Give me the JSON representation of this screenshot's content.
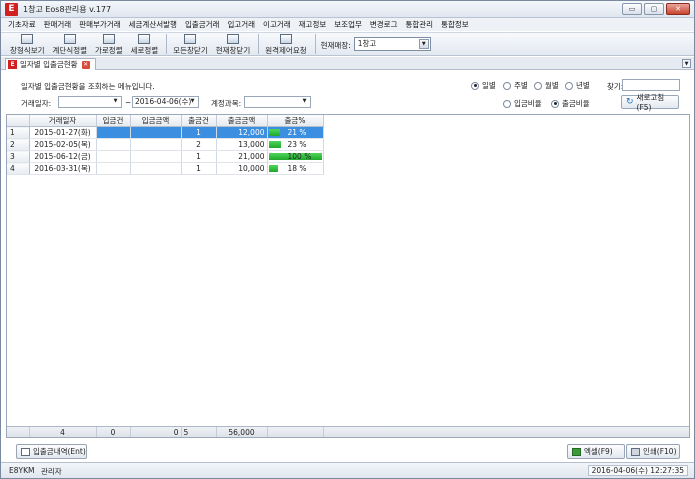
{
  "window": {
    "title": "1창고 Eos8관리용 v.177",
    "logo": "E",
    "btn_min": "▭",
    "btn_max": "▢",
    "btn_close": "✕"
  },
  "menu": [
    "기초자료",
    "판매거래",
    "판매부가거래",
    "세금계산서발행",
    "입출금거래",
    "입고거래",
    "이고거래",
    "재고정보",
    "보조업무",
    "변경로그",
    "통합관리",
    "통합정보"
  ],
  "toolbar": {
    "buttons": [
      "창형식보기",
      "계단식정렬",
      "가로정렬",
      "세로정렬",
      "모든창닫기",
      "현재창닫기",
      "원격제어요청"
    ],
    "store_label": "현재매장:",
    "store_value": "1창고"
  },
  "tab": {
    "label": "일자별 입출금현황",
    "logo": "E",
    "close": "✕",
    "menu_arrow": "▼"
  },
  "filters": {
    "description": "일자별 입출금현황을 조회하는 메뉴입니다.",
    "date_label": "거래일자:",
    "date_from": "",
    "date_sep": "~",
    "date_to": "2016-04-06(수)",
    "account_label": "계정과목:",
    "account_value": "",
    "find_label": "찾기:",
    "find_value": "",
    "period_options": [
      {
        "label": "일별",
        "selected": true
      },
      {
        "label": "주별",
        "selected": false
      },
      {
        "label": "월별",
        "selected": false
      },
      {
        "label": "년별",
        "selected": false
      }
    ],
    "ratio_options": [
      {
        "label": "입금비율",
        "selected": false
      },
      {
        "label": "출금비율",
        "selected": true
      }
    ],
    "refresh_label": "새로고침(F5)",
    "refresh_icon": "↻"
  },
  "grid": {
    "columns": [
      "거래일자",
      "입금건",
      "입금금액",
      "출금건",
      "출금금액",
      "출금%"
    ],
    "rows": [
      {
        "no": "1",
        "date": "2015-01-27(화)",
        "in_cnt": "",
        "in_amt": "",
        "out_cnt": "1",
        "out_amt": "12,000",
        "pct": 21,
        "pct_text": "21 %"
      },
      {
        "no": "2",
        "date": "2015-02-05(목)",
        "in_cnt": "",
        "in_amt": "",
        "out_cnt": "2",
        "out_amt": "13,000",
        "pct": 23,
        "pct_text": "23 %"
      },
      {
        "no": "3",
        "date": "2015-06-12(금)",
        "in_cnt": "",
        "in_amt": "",
        "out_cnt": "1",
        "out_amt": "21,000",
        "pct": 100,
        "pct_text": "100 %"
      },
      {
        "no": "4",
        "date": "2016-03-31(목)",
        "in_cnt": "",
        "in_amt": "",
        "out_cnt": "1",
        "out_amt": "10,000",
        "pct": 18,
        "pct_text": "18 %"
      }
    ],
    "totals": {
      "date": "4",
      "in_cnt": "0",
      "in_amt": "0",
      "out_cnt": "5",
      "out_amt": "56,000"
    }
  },
  "buttons": {
    "detail": "입출금내역(Ent)",
    "excel": "엑셀(F9)",
    "print": "인쇄(F10)"
  },
  "status": {
    "code": "E8YKM",
    "user": "관리자",
    "datetime": "2016-04-06(수) 12:27:35"
  }
}
